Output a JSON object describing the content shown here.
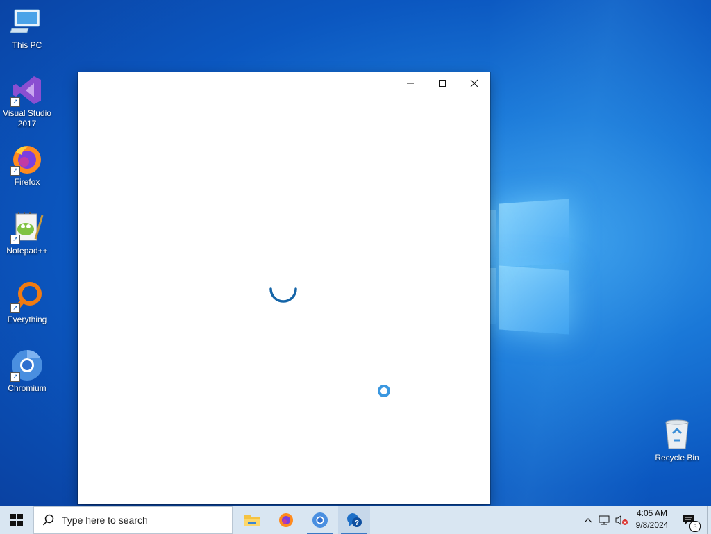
{
  "desktop": {
    "icons": [
      {
        "label": "This PC"
      },
      {
        "label": "Visual Studio 2017"
      },
      {
        "label": "Firefox"
      },
      {
        "label": "Notepad++"
      },
      {
        "label": "Everything"
      },
      {
        "label": "Chromium"
      },
      {
        "label": "Recycle Bin"
      }
    ]
  },
  "window": {
    "controls": {
      "minimize": "minimize-icon",
      "maximize": "maximize-icon",
      "close": "close-icon"
    },
    "state": "loading"
  },
  "taskbar": {
    "search_placeholder": "Type here to search",
    "apps": [
      "File Explorer",
      "Firefox",
      "Chromium",
      "Get Help"
    ],
    "clock_time": "4:05 AM",
    "clock_date": "9/8/2024",
    "notification_count": "3"
  },
  "colors": {
    "spinner": "#1565a8",
    "accent": "#0b57c0"
  }
}
